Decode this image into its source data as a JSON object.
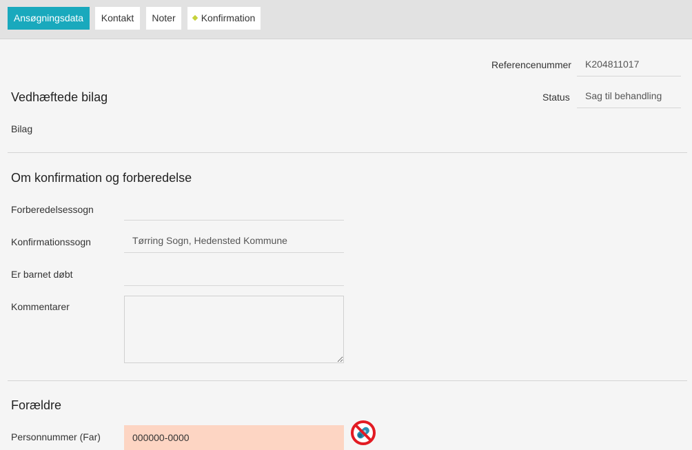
{
  "tabs": [
    {
      "label": "Ansøgningsdata",
      "active": true
    },
    {
      "label": "Kontakt",
      "active": false
    },
    {
      "label": "Noter",
      "active": false
    },
    {
      "label": "Konfirmation",
      "active": false
    }
  ],
  "meta": {
    "reference_label": "Referencenummer",
    "reference_value": "K204811017",
    "status_label": "Status",
    "status_value": "Sag til behandling"
  },
  "attachments": {
    "heading": "Vedhæftede bilag",
    "bilag_label": "Bilag"
  },
  "confirmation": {
    "heading": "Om konfirmation og forberedelse",
    "prep_parish_label": "Forberedelsessogn",
    "prep_parish_value": "",
    "conf_parish_label": "Konfirmationssogn",
    "conf_parish_value": "Tørring Sogn, Hedensted Kommune",
    "baptized_label": "Er barnet døbt",
    "baptized_value": "",
    "comments_label": "Kommentarer",
    "comments_value": ""
  },
  "parents": {
    "heading": "Forældre",
    "father_cpr_label": "Personnummer (Far)",
    "father_cpr_value": "000000-0000"
  },
  "icons": {
    "lookup_blocked": "no-lookup-icon"
  },
  "colors": {
    "accent": "#19a9bd",
    "error_field": "#fdd5c3",
    "blocked_red": "#e21b23"
  }
}
